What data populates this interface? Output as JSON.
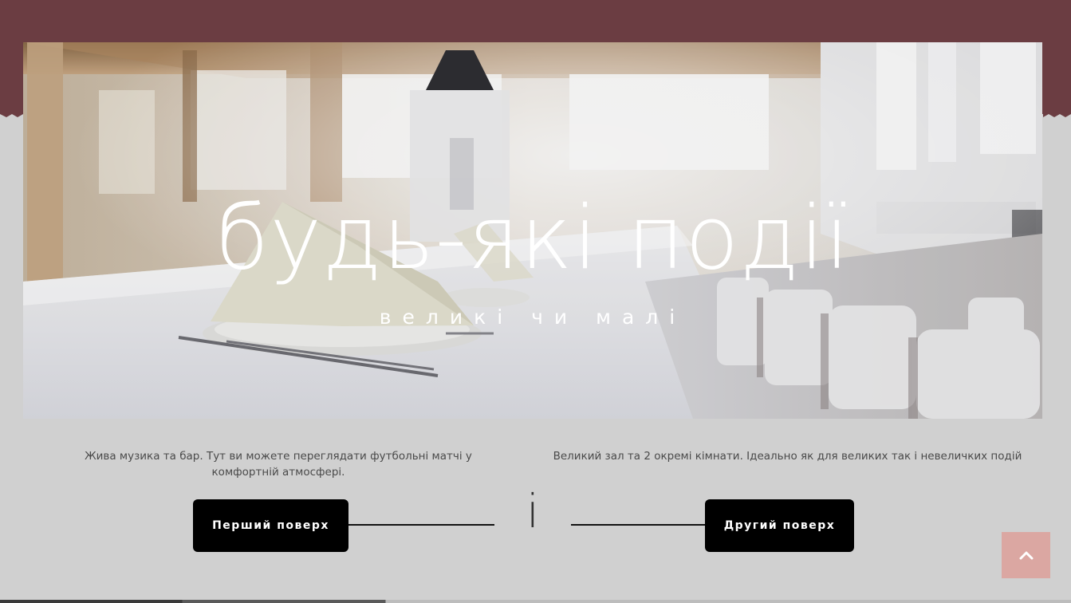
{
  "hero": {
    "title": "будь-які події",
    "subtitle": "великі чи малі"
  },
  "floors": {
    "first": {
      "description": "Жива музика та бар. Тут ви можете переглядати футбольні матчі у комфортній атмосфері.",
      "button_label": "Перший поверх"
    },
    "second": {
      "description": "Великий зал та 2 окремі кімнати. Ідеально як для великих так і невеличких подій",
      "button_label": "Другий поверх"
    },
    "divider_glyph": "і"
  },
  "colors": {
    "top_band": "#6b3d42",
    "background": "#d0d0d0",
    "button_bg": "#000000",
    "back_to_top": "#dba7a2"
  },
  "icons": {
    "back_to_top": "chevron-up-icon"
  }
}
